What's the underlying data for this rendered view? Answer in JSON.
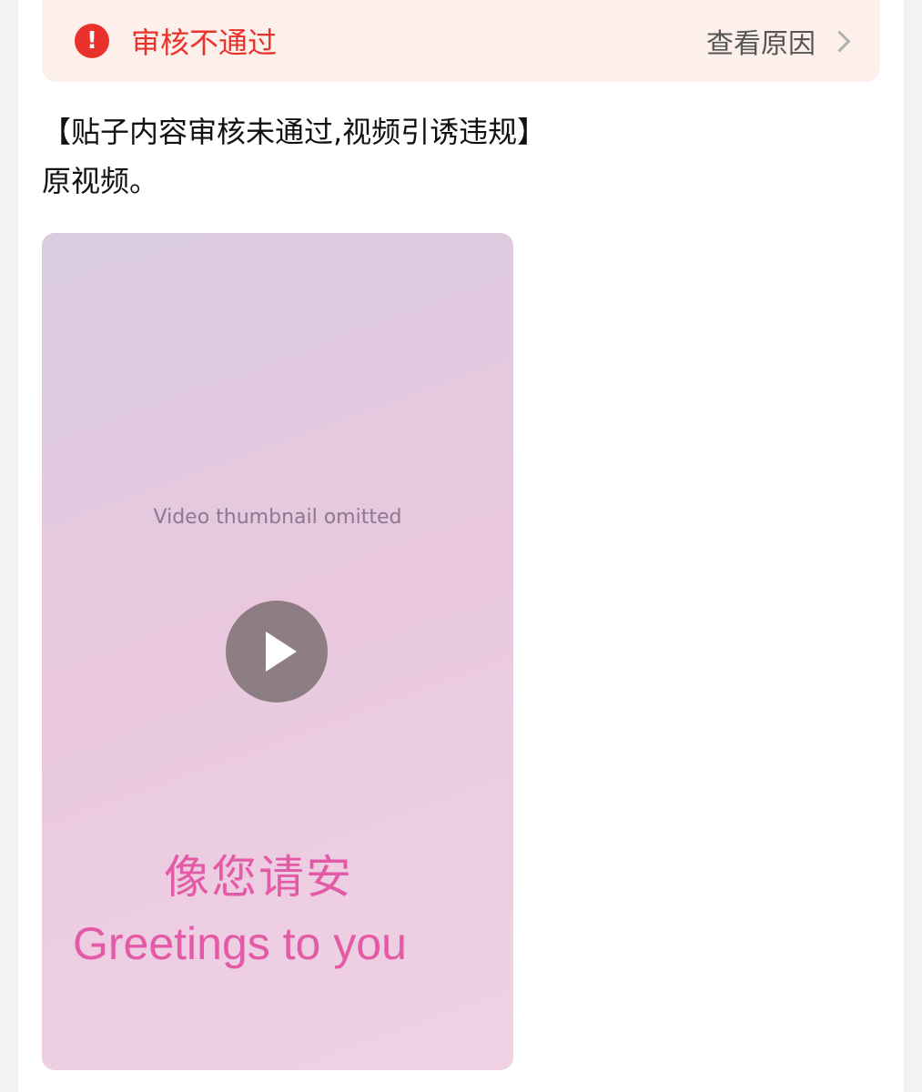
{
  "review_banner": {
    "icon": "exclamation-circle-icon",
    "icon_glyph": "!",
    "status": "审核不通过",
    "action_label": "查看原因",
    "accent_color": "#e8322b",
    "background_color": "#fdf0ea"
  },
  "post": {
    "line1": "【贴子内容审核未通过,视频引诱违规】",
    "line2": "原视频。"
  },
  "video": {
    "thumbnail_note": "Video thumbnail omitted",
    "caption_cn": "像您请安",
    "caption_en": "Greetings to you",
    "caption_color": "#e35aa6"
  }
}
